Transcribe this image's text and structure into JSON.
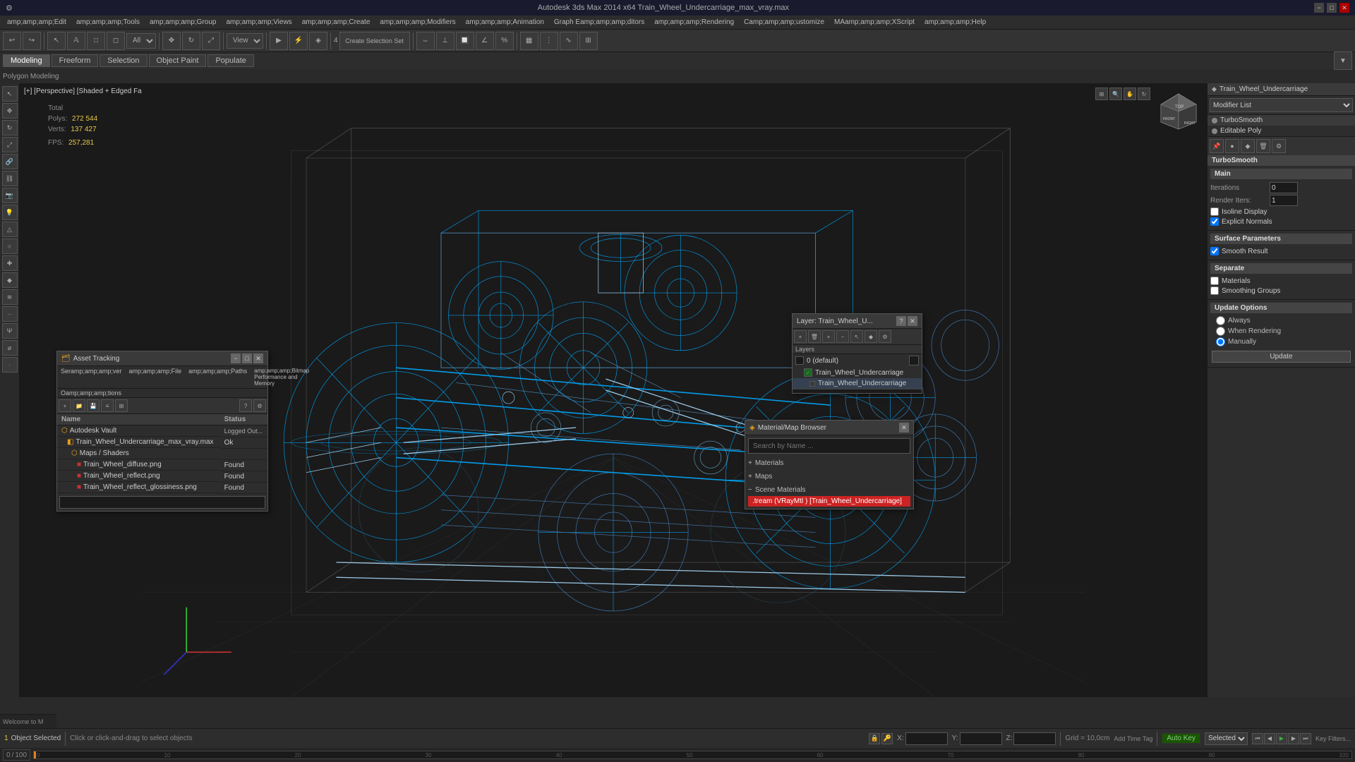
{
  "titleBar": {
    "title": "Autodesk 3ds Max 2014 x64   Train_Wheel_Undercarriage_max_vray.max",
    "minBtn": "−",
    "maxBtn": "□",
    "closeBtn": "✕"
  },
  "menuBar": {
    "items": [
      "amp;amp;amp;Edit",
      "amp;amp;amp;Tools",
      "amp;amp;amp;Group",
      "amp;amp;amp;Views",
      "amp;amp;amp;Create",
      "amp;amp;amp;Modifiers",
      "amp;amp;amp;Animation",
      "Graph Eamp;amp;amp;ditors",
      "amp;amp;amp;Rendering",
      "Camp;amp;amp;ustomize",
      "MAamp;amp;amp;XScript",
      "amp;amp;amp;Help"
    ]
  },
  "tabBar": {
    "tabs": [
      "Modeling",
      "Freeform",
      "Selection",
      "Object Paint",
      "Populate"
    ]
  },
  "subTabBar": {
    "label": "Polygon Modeling"
  },
  "viewport": {
    "label": "[+] [Perspective] [Shaded + Edged Faces]",
    "stats": {
      "totalLabel": "Total",
      "polysLabel": "Polys:",
      "polysValue": "272 544",
      "vertsLabel": "Verts:",
      "vertsValue": "137 427",
      "fpsLabel": "FPS:",
      "fpsValue": "257,281"
    }
  },
  "rightPanel": {
    "objectName": "Train_Wheel_Undercarriage",
    "modifierList": "Modifier List",
    "modifiers": [
      "TurboSmooth",
      "Editable Poly"
    ],
    "turbosmoothTitle": "TurboSmooth",
    "sections": {
      "main": {
        "title": "Main",
        "iterations": "0",
        "renderIters": "1",
        "isolineDisplay": "Isoline Display",
        "explicitNormals": "Explicit Normals"
      },
      "surfaceParams": {
        "title": "Surface Parameters",
        "smoothResult": "Smooth Result"
      },
      "separate": {
        "title": "Separate",
        "materials": "Materials",
        "smoothingGroups": "Smoothing Groups"
      },
      "updateOptions": {
        "title": "Update Options",
        "always": "Always",
        "whenRendering": "When Rendering",
        "manually": "Manually",
        "updateBtn": "Update"
      }
    }
  },
  "assetTracking": {
    "title": "Asset Tracking",
    "menuItems": [
      "Seramp;amp;amp;ver",
      "amp;amp;amp;File",
      "amp;amp;amp;Paths",
      "amp;amp;amp;Bitmap Performance and Memory",
      "Oamp;amp;amp;tions"
    ],
    "columns": [
      "Name",
      "Status"
    ],
    "rows": [
      {
        "name": "Autodesk Vault",
        "status": "Logged Out...",
        "type": "vault"
      },
      {
        "name": "Train_Wheel_Undercarriage_max_vray.max",
        "status": "Ok",
        "type": "file"
      },
      {
        "name": "Maps / Shaders",
        "status": "",
        "type": "group"
      },
      {
        "name": "Train_Wheel_diffuse.png",
        "status": "Found",
        "type": "map"
      },
      {
        "name": "Train_Wheel_reflect.png",
        "status": "Found",
        "type": "map"
      },
      {
        "name": "Train_Wheel_reflect_glossiness.png",
        "status": "Found",
        "type": "map"
      }
    ]
  },
  "layerPanel": {
    "title": "Layer: Train_Wheel_U...",
    "layers": [
      {
        "name": "0 (default)",
        "active": false,
        "indent": 0
      },
      {
        "name": "Train_Wheel_Undercarriage",
        "active": false,
        "indent": 1
      },
      {
        "name": "Train_Wheel_Undercarriage",
        "active": true,
        "indent": 2
      }
    ]
  },
  "materialBrowser": {
    "title": "Material/Map Browser",
    "searchPlaceholder": "Search by Name ...",
    "sections": {
      "materials": "+ Materials",
      "maps": "+ Maps",
      "sceneMaterials": "Scene Materials"
    },
    "sceneMaterial": ".tream  (VRayMtl ) [Train_Wheel_Undercarriage]"
  },
  "bottomBar": {
    "objectSelected": "1 Object Selected",
    "hint": "Click or click-and-drag to select objects",
    "coordLabels": [
      "X:",
      "Y:",
      "Z:"
    ],
    "gridLabel": "Grid = 10,0cm",
    "autoKeyLabel": "Auto Key",
    "selectedLabel": "Selected",
    "keyFilters": "Key Filters...",
    "timeTag": "Add Time Tag",
    "timeline": {
      "current": "0",
      "total": "100"
    }
  },
  "icons": {
    "folder": "📁",
    "file": "📄",
    "map": "🖼",
    "plus": "+",
    "minus": "−",
    "close": "✕",
    "check": "✓",
    "arrow": "▶",
    "arrowLeft": "◀",
    "dot": "●",
    "lock": "🔒",
    "key": "🔑",
    "globe": "🌐",
    "camera": "📷",
    "light": "💡",
    "gear": "⚙",
    "search": "🔍",
    "layer": "▦",
    "material": "◈",
    "refresh": "↺",
    "play": "▶",
    "stop": "■",
    "skipEnd": "⏭",
    "skipStart": "⏮",
    "nextFrame": "⏩",
    "prevFrame": "⏪"
  }
}
